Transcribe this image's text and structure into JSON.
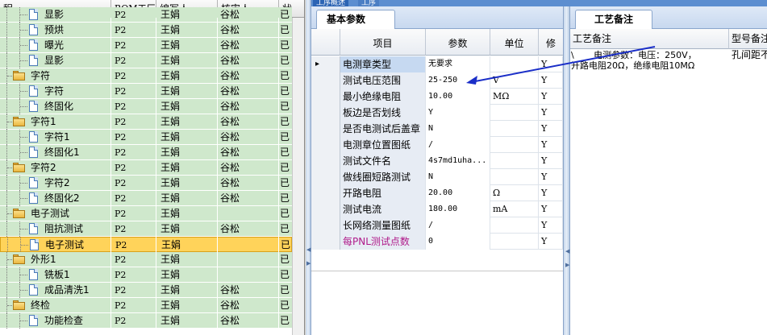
{
  "left_tree": {
    "columns": {
      "name": "程",
      "bom": "BOM工厂",
      "author": "编写人",
      "reviewer": "核审人",
      "status": "状"
    },
    "rows": [
      {
        "name": "显影",
        "indent": 2,
        "kind": "doc",
        "bom": "P2",
        "author": "王娟",
        "reviewer": "谷松",
        "status": "已",
        "selected": false
      },
      {
        "name": "预烘",
        "indent": 2,
        "kind": "doc",
        "bom": "P2",
        "author": "王娟",
        "reviewer": "谷松",
        "status": "已",
        "selected": false
      },
      {
        "name": "曝光",
        "indent": 2,
        "kind": "doc",
        "bom": "P2",
        "author": "王娟",
        "reviewer": "谷松",
        "status": "已",
        "selected": false
      },
      {
        "name": "显影",
        "indent": 2,
        "kind": "doc",
        "bom": "P2",
        "author": "王娟",
        "reviewer": "谷松",
        "status": "已",
        "selected": false
      },
      {
        "name": "字符",
        "indent": 1,
        "kind": "folder",
        "bom": "P2",
        "author": "王娟",
        "reviewer": "谷松",
        "status": "已",
        "selected": false
      },
      {
        "name": "字符",
        "indent": 2,
        "kind": "doc",
        "bom": "P2",
        "author": "王娟",
        "reviewer": "谷松",
        "status": "已",
        "selected": false
      },
      {
        "name": "终固化",
        "indent": 2,
        "kind": "doc",
        "bom": "P2",
        "author": "王娟",
        "reviewer": "谷松",
        "status": "已",
        "selected": false
      },
      {
        "name": "字符1",
        "indent": 1,
        "kind": "folder",
        "bom": "P2",
        "author": "王娟",
        "reviewer": "谷松",
        "status": "已",
        "selected": false
      },
      {
        "name": "字符1",
        "indent": 2,
        "kind": "doc",
        "bom": "P2",
        "author": "王娟",
        "reviewer": "谷松",
        "status": "已",
        "selected": false
      },
      {
        "name": "终固化1",
        "indent": 2,
        "kind": "doc",
        "bom": "P2",
        "author": "王娟",
        "reviewer": "谷松",
        "status": "已",
        "selected": false
      },
      {
        "name": "字符2",
        "indent": 1,
        "kind": "folder",
        "bom": "P2",
        "author": "王娟",
        "reviewer": "谷松",
        "status": "已",
        "selected": false
      },
      {
        "name": "字符2",
        "indent": 2,
        "kind": "doc",
        "bom": "P2",
        "author": "王娟",
        "reviewer": "谷松",
        "status": "已",
        "selected": false
      },
      {
        "name": "终固化2",
        "indent": 2,
        "kind": "doc",
        "bom": "P2",
        "author": "王娟",
        "reviewer": "谷松",
        "status": "已",
        "selected": false
      },
      {
        "name": "电子测试",
        "indent": 1,
        "kind": "folder",
        "bom": "P2",
        "author": "王娟",
        "reviewer": "",
        "status": "已",
        "selected": false
      },
      {
        "name": "阻抗测试",
        "indent": 2,
        "kind": "doc",
        "bom": "P2",
        "author": "王娟",
        "reviewer": "谷松",
        "status": "已",
        "selected": false
      },
      {
        "name": "电子测试",
        "indent": 2,
        "kind": "doc",
        "bom": "P2",
        "author": "王娟",
        "reviewer": "",
        "status": "已",
        "selected": true
      },
      {
        "name": "外形1",
        "indent": 1,
        "kind": "folder",
        "bom": "P2",
        "author": "王娟",
        "reviewer": "",
        "status": "已",
        "selected": false
      },
      {
        "name": "铣板1",
        "indent": 2,
        "kind": "doc",
        "bom": "P2",
        "author": "王娟",
        "reviewer": "",
        "status": "已",
        "selected": false
      },
      {
        "name": "成品清洗1",
        "indent": 2,
        "kind": "doc",
        "bom": "P2",
        "author": "王娟",
        "reviewer": "谷松",
        "status": "已",
        "selected": false
      },
      {
        "name": "终检",
        "indent": 1,
        "kind": "folder",
        "bom": "P2",
        "author": "王娟",
        "reviewer": "谷松",
        "status": "已",
        "selected": false
      },
      {
        "name": "功能检查",
        "indent": 2,
        "kind": "doc",
        "bom": "P2",
        "author": "王娟",
        "reviewer": "谷松",
        "status": "已",
        "selected": false
      }
    ]
  },
  "top_tabs": [
    "工序概述",
    "工序"
  ],
  "center": {
    "tab_label": "基本参数",
    "columns": {
      "item": "项目",
      "param": "参数",
      "unit": "单位",
      "modify": "修"
    },
    "rows": [
      {
        "item": "电测章类型",
        "param": "无要求",
        "unit": "",
        "modify": "Y",
        "current": true,
        "edit": true
      },
      {
        "item": "测试电压范围",
        "param": "25-250",
        "unit": "V",
        "modify": "Y",
        "current": false,
        "edit": true
      },
      {
        "item": "最小绝缘电阻",
        "param": "10.00",
        "unit": "MΩ",
        "modify": "Y",
        "current": false,
        "edit": true
      },
      {
        "item": "板边是否划线",
        "param": "Y",
        "unit": "",
        "modify": "Y",
        "current": false,
        "edit": false
      },
      {
        "item": "是否电测试后盖章",
        "param": "N",
        "unit": "",
        "modify": "Y",
        "current": false,
        "edit": true
      },
      {
        "item": "电测章位置图纸",
        "param": "/",
        "unit": "",
        "modify": "Y",
        "current": false,
        "edit": true
      },
      {
        "item": "测试文件名",
        "param": "4s7md1uha...",
        "unit": "",
        "modify": "Y",
        "current": false,
        "edit": false
      },
      {
        "item": "做线圈短路测试",
        "param": "N",
        "unit": "",
        "modify": "Y",
        "current": false,
        "edit": false
      },
      {
        "item": "开路电阻",
        "param": "20.00",
        "unit": "Ω",
        "modify": "Y",
        "current": false,
        "edit": true
      },
      {
        "item": "测试电流",
        "param": "180.00",
        "unit": "mA",
        "modify": "Y",
        "current": false,
        "edit": true
      },
      {
        "item": "长网络测量图纸",
        "param": "/",
        "unit": "",
        "modify": "Y",
        "current": false,
        "edit": true
      },
      {
        "item": "每PNL测试点数",
        "param": "0",
        "unit": "",
        "modify": "Y",
        "current": false,
        "edit": false,
        "highlight": true
      }
    ],
    "highlight_color": "#b01a8a"
  },
  "right": {
    "tab_label": "工艺备注",
    "columns": {
      "note": "工艺备注",
      "model_note": "型号备注"
    },
    "note_text_line1": "\\       电测参数：电压：250V，",
    "note_text_line2": "开路电阻20Ω，绝缘电阻10MΩ",
    "model_note_text": "孔间距不"
  },
  "colors": {
    "tree_bg": "#cfe8cc",
    "selected_row": "#ffd35a",
    "arrow": "#1a2ec8"
  }
}
